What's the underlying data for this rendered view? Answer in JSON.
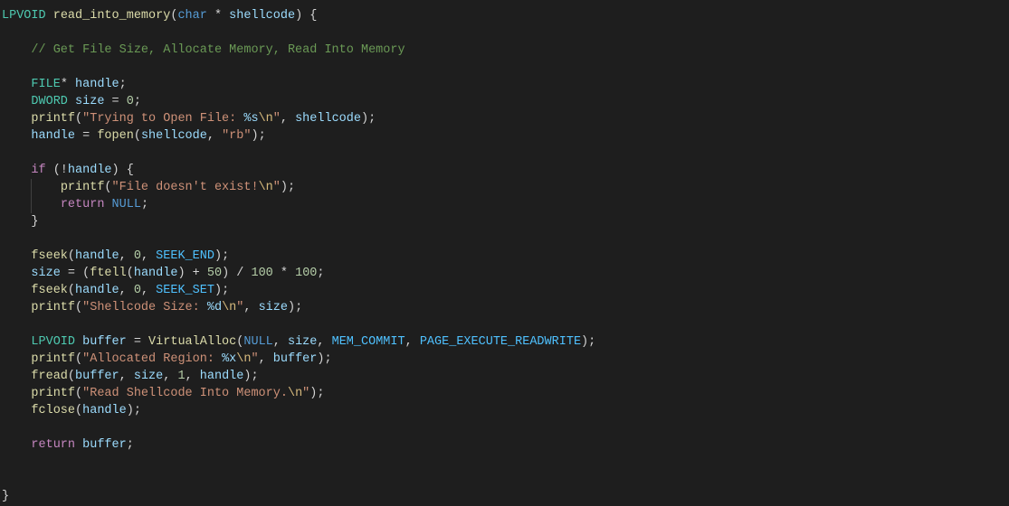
{
  "code": {
    "l1": {
      "t1": "LPVOID ",
      "t2": "read_into_memory",
      "t3": "(",
      "t4": "char",
      "t5": " * ",
      "t6": "shellcode",
      "t7": ") {"
    },
    "l3": {
      "t1": "    ",
      "t2": "// Get File Size, Allocate Memory, Read Into Memory"
    },
    "l5": {
      "t1": "    ",
      "t2": "FILE",
      "t3": "* ",
      "t4": "handle",
      "t5": ";"
    },
    "l6": {
      "t1": "    ",
      "t2": "DWORD ",
      "t3": "size",
      "t4": " = ",
      "t5": "0",
      "t6": ";"
    },
    "l7": {
      "t1": "    ",
      "t2": "printf",
      "t3": "(",
      "t4": "\"Trying to Open File: ",
      "t5": "%s",
      "t6": "\\n",
      "t7": "\"",
      "t8": ", ",
      "t9": "shellcode",
      "t10": ");"
    },
    "l8": {
      "t1": "    ",
      "t2": "handle",
      "t3": " = ",
      "t4": "fopen",
      "t5": "(",
      "t6": "shellcode",
      "t7": ", ",
      "t8": "\"rb\"",
      "t9": ");"
    },
    "l10": {
      "t1": "    ",
      "t2": "if",
      "t3": " (!",
      "t4": "handle",
      "t5": ") {"
    },
    "l11": {
      "t1": "        ",
      "t2": "printf",
      "t3": "(",
      "t4": "\"File doesn't exist!",
      "t5": "\\n",
      "t6": "\"",
      "t7": ");"
    },
    "l12": {
      "t1": "        ",
      "t2": "return",
      "t3": " ",
      "t4": "NULL",
      "t5": ";"
    },
    "l13": {
      "t1": "    ",
      "t2": "}"
    },
    "l15": {
      "t1": "    ",
      "t2": "fseek",
      "t3": "(",
      "t4": "handle",
      "t5": ", ",
      "t6": "0",
      "t7": ", ",
      "t8": "SEEK_END",
      "t9": ");"
    },
    "l16": {
      "t1": "    ",
      "t2": "size",
      "t3": " = (",
      "t4": "ftell",
      "t5": "(",
      "t6": "handle",
      "t7": ") + ",
      "t8": "50",
      "t9": ") / ",
      "t10": "100",
      "t11": " * ",
      "t12": "100",
      "t13": ";"
    },
    "l17": {
      "t1": "    ",
      "t2": "fseek",
      "t3": "(",
      "t4": "handle",
      "t5": ", ",
      "t6": "0",
      "t7": ", ",
      "t8": "SEEK_SET",
      "t9": ");"
    },
    "l18": {
      "t1": "    ",
      "t2": "printf",
      "t3": "(",
      "t4": "\"Shellcode Size: ",
      "t5": "%d",
      "t6": "\\n",
      "t7": "\"",
      "t8": ", ",
      "t9": "size",
      "t10": ");"
    },
    "l20": {
      "t1": "    ",
      "t2": "LPVOID ",
      "t3": "buffer",
      "t4": " = ",
      "t5": "VirtualAlloc",
      "t6": "(",
      "t7": "NULL",
      "t8": ", ",
      "t9": "size",
      "t10": ", ",
      "t11": "MEM_COMMIT",
      "t12": ", ",
      "t13": "PAGE_EXECUTE_READWRITE",
      "t14": ");"
    },
    "l21": {
      "t1": "    ",
      "t2": "printf",
      "t3": "(",
      "t4": "\"Allocated Region: ",
      "t5": "%x",
      "t6": "\\n",
      "t7": "\"",
      "t8": ", ",
      "t9": "buffer",
      "t10": ");"
    },
    "l22": {
      "t1": "    ",
      "t2": "fread",
      "t3": "(",
      "t4": "buffer",
      "t5": ", ",
      "t6": "size",
      "t7": ", ",
      "t8": "1",
      "t9": ", ",
      "t10": "handle",
      "t11": ");"
    },
    "l23": {
      "t1": "    ",
      "t2": "printf",
      "t3": "(",
      "t4": "\"Read Shellcode Into Memory.",
      "t5": "\\n",
      "t6": "\"",
      "t7": ");"
    },
    "l24": {
      "t1": "    ",
      "t2": "fclose",
      "t3": "(",
      "t4": "handle",
      "t5": ");"
    },
    "l26": {
      "t1": "    ",
      "t2": "return",
      "t3": " ",
      "t4": "buffer",
      "t5": ";"
    },
    "l29": {
      "t1": "}"
    }
  }
}
